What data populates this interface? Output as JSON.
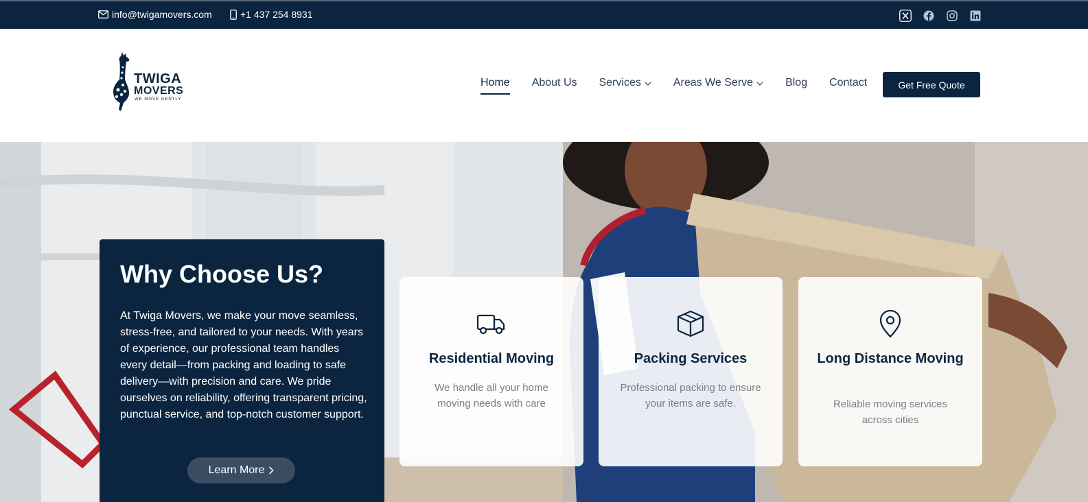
{
  "topbar": {
    "email": "info@twigamovers.com",
    "phone": "+1 437 254 8931",
    "socials": [
      "x-icon",
      "facebook-icon",
      "instagram-icon",
      "linkedin-icon"
    ]
  },
  "logo": {
    "line1": "TWIGA",
    "line2": "MOVERS",
    "tagline": "WE MOVE GENTLY"
  },
  "nav": {
    "items": [
      {
        "label": "Home",
        "active": true
      },
      {
        "label": "About Us"
      },
      {
        "label": "Services",
        "dropdown": true
      },
      {
        "label": "Areas We Serve",
        "dropdown": true
      },
      {
        "label": "Blog"
      },
      {
        "label": "Contact"
      }
    ],
    "cta": "Get Free Quote"
  },
  "why": {
    "title": "Why Choose Us?",
    "text": "At Twiga Movers, we make your move seamless, stress-free, and tailored to your needs. With years of experience, our professional team handles every detail—from packing and loading to safe delivery—with precision and care. We pride ourselves on reliability, offering transparent pricing, punctual service, and top-notch customer support.",
    "button": "Learn More"
  },
  "cards": [
    {
      "icon": "truck-icon",
      "title": "Residential Moving",
      "desc": "We handle all your home moving needs with care"
    },
    {
      "icon": "box-icon",
      "title": "Packing Services",
      "desc": "Professional packing to ensure your items are safe."
    },
    {
      "icon": "location-pin-icon",
      "title": "Long Distance Moving",
      "desc": "Reliable moving services across cities"
    }
  ],
  "colors": {
    "navy": "#0b2540",
    "text_gray": "#7a7f86"
  }
}
